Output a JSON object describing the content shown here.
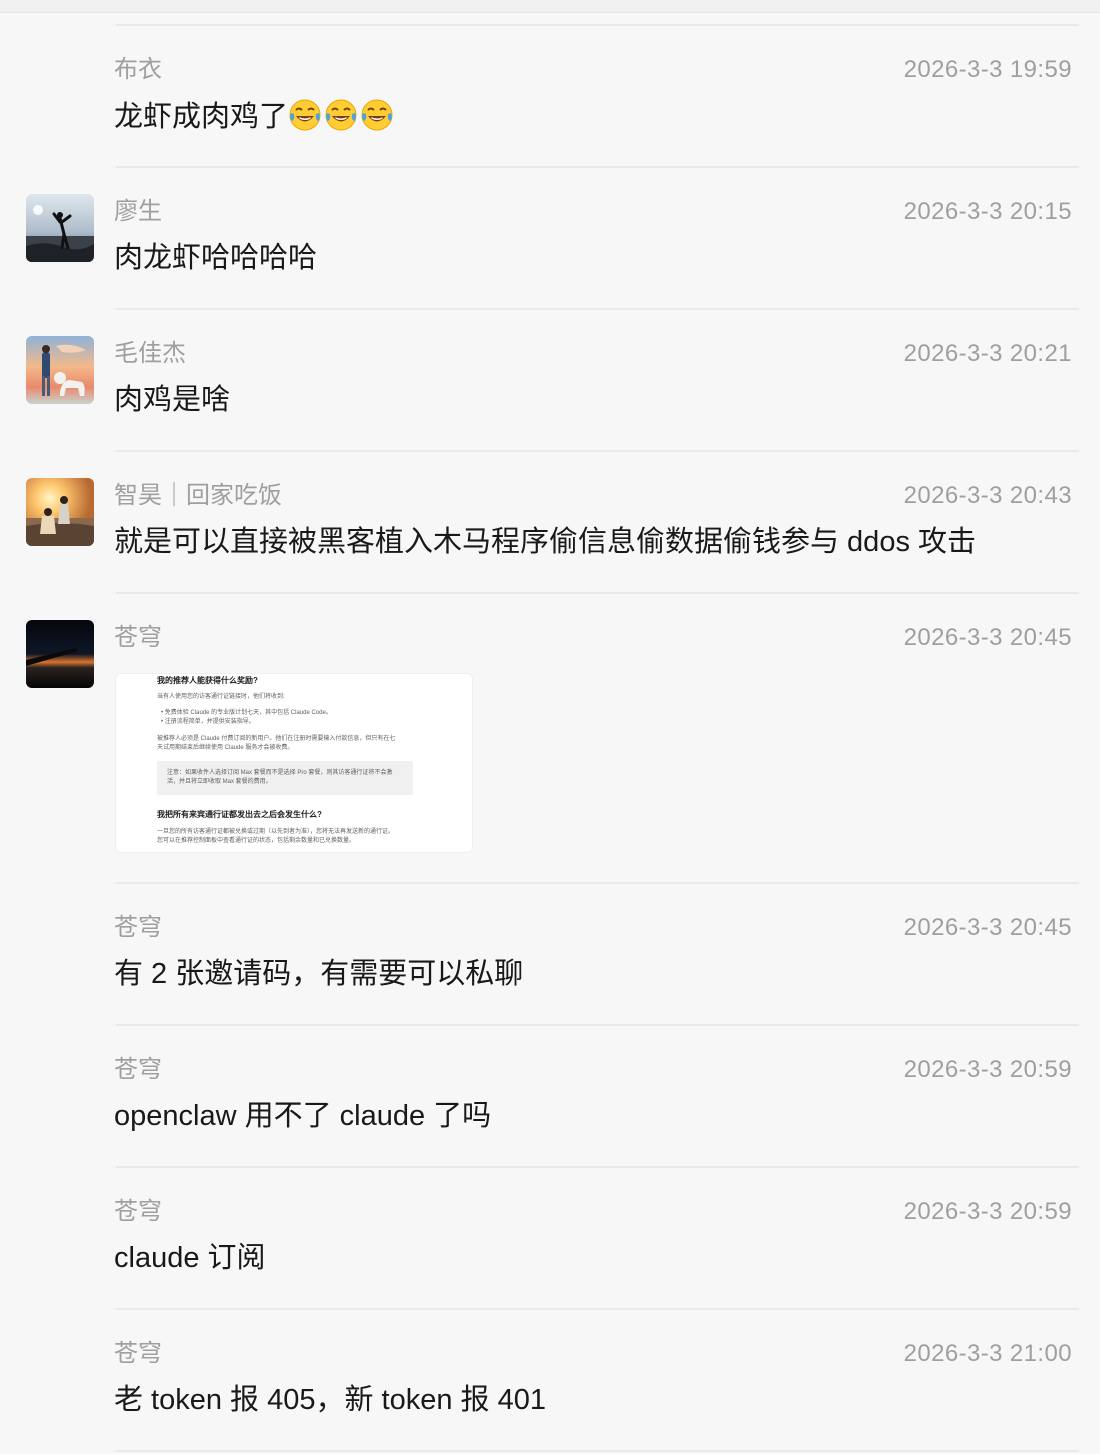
{
  "messages": [
    {
      "name": "布衣",
      "time": "2026-3-3 19:59",
      "text": "龙虾成肉鸡了",
      "emojis": [
        "tears-of-joy-emoji",
        "tears-of-joy-emoji",
        "tears-of-joy-emoji"
      ],
      "has_avatar": false
    },
    {
      "name": "廖生",
      "time": "2026-3-3 20:15",
      "text": "肉龙虾哈哈哈哈",
      "avatar": "seaside-jumping-person-avatar"
    },
    {
      "name": "毛佳杰",
      "time": "2026-3-3 20:21",
      "text": "肉鸡是啥",
      "avatar": "sunset-person-with-dog-avatar"
    },
    {
      "name": "智昊｜回家吃饭",
      "time": "2026-3-3 20:43",
      "text": "就是可以直接被黑客植入木马程序偷信息偷数据偷钱参与 ddos 攻击",
      "avatar": "beach-sunset-couple-avatar"
    },
    {
      "name": "苍穹",
      "time": "2026-3-3 20:45",
      "avatar": "night-sky-airplane-wing-avatar",
      "image": {
        "heading1": "我的推荐人能获得什么奖励?",
        "intro": "当有人使用您的访客通行证链接时，他们将收到:",
        "bullet1": "• 免费体验 Claude 的专业版计划七天，其中包括 Claude Code。",
        "bullet2": "• 注册流程简单，并提供安装指导。",
        "para1": "被推荐人必须是 Claude 付费订阅的新用户。他们在注册时需要输入付款信息，但只有在七",
        "para2": "天试用期结束后继续使用 Claude 服务才会被收费。",
        "note1": "注意：如果收件人选择订阅 Max 套餐而不是选择 Pro 套餐，则其访客通行证将不会激",
        "note2": "活，并且将立即收取 Max 套餐的费用。",
        "heading2": "我把所有来宾通行证都发出去之后会发生什么?",
        "para3": "一旦您的所有访客通行证都被兑换或过期（以先到者为准），您将无法再发送新的通行证。",
        "para4": "您可以在推荐控制面板中查看通行证的状态，包括剩余数量和已兑换数量。"
      }
    },
    {
      "name": "苍穹",
      "time": "2026-3-3 20:45",
      "text": "有 2 张邀请码，有需要可以私聊",
      "has_avatar": false
    },
    {
      "name": "苍穹",
      "time": "2026-3-3 20:59",
      "text": "openclaw 用不了 claude 了吗",
      "has_avatar": false
    },
    {
      "name": "苍穹",
      "time": "2026-3-3 20:59",
      "text": "claude 订阅",
      "has_avatar": false
    },
    {
      "name": "苍穹",
      "time": "2026-3-3 21:00",
      "text": "老 token 报 405，新 token 报 401",
      "has_avatar": false
    }
  ]
}
